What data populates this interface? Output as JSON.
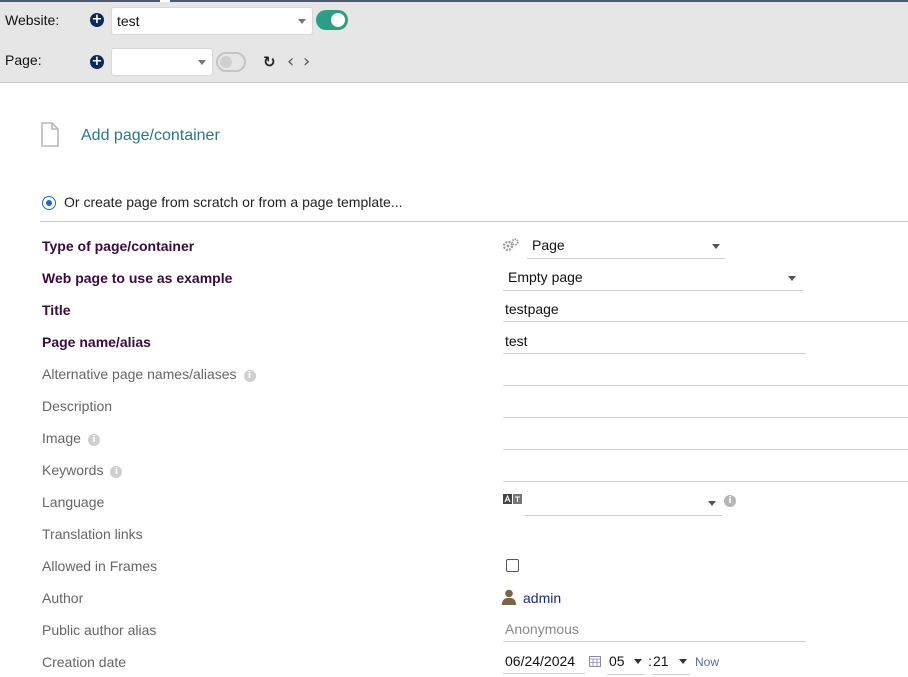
{
  "toolbar": {
    "website_label": "Website:",
    "website_value": "test",
    "page_label": "Page:",
    "page_value": ""
  },
  "icons": {
    "add": "plus-circle-icon",
    "refresh": "refresh-icon",
    "prev": "chevron-left-icon",
    "next": "chevron-right-icon",
    "doc": "document-icon",
    "gears": "gears-icon",
    "translate": "translate-icon",
    "user": "user-icon",
    "calendar": "calendar-icon",
    "info": "info-icon"
  },
  "add_page": {
    "label": "Add page/container"
  },
  "create_option": {
    "label": "Or create page from scratch or from a page template..."
  },
  "form": {
    "type": {
      "label": "Type of page/container",
      "value": "Page"
    },
    "example": {
      "label": "Web page to use as example",
      "value": "Empty page"
    },
    "title": {
      "label": "Title",
      "value": "testpage"
    },
    "pagename": {
      "label": "Page name/alias",
      "value": "test"
    },
    "altnames": {
      "label": "Alternative page names/aliases",
      "value": ""
    },
    "description": {
      "label": "Description",
      "value": ""
    },
    "image": {
      "label": "Image",
      "value": ""
    },
    "keywords": {
      "label": "Keywords",
      "value": ""
    },
    "language": {
      "label": "Language",
      "value": ""
    },
    "translation": {
      "label": "Translation links"
    },
    "frames": {
      "label": "Allowed in Frames",
      "checked": false
    },
    "author": {
      "label": "Author",
      "value": "admin"
    },
    "public_alias": {
      "label": "Public author alias",
      "placeholder": "Anonymous"
    },
    "creation": {
      "label": "Creation date",
      "date": "06/24/2024",
      "hour": "05",
      "minute": "21",
      "now_label": "Now",
      "separator": ":"
    }
  },
  "colors": {
    "required_label": "#3b0a3e",
    "link": "#2a7a85",
    "toggle_on": "#2d9e86",
    "radio": "#1b6bc4"
  }
}
